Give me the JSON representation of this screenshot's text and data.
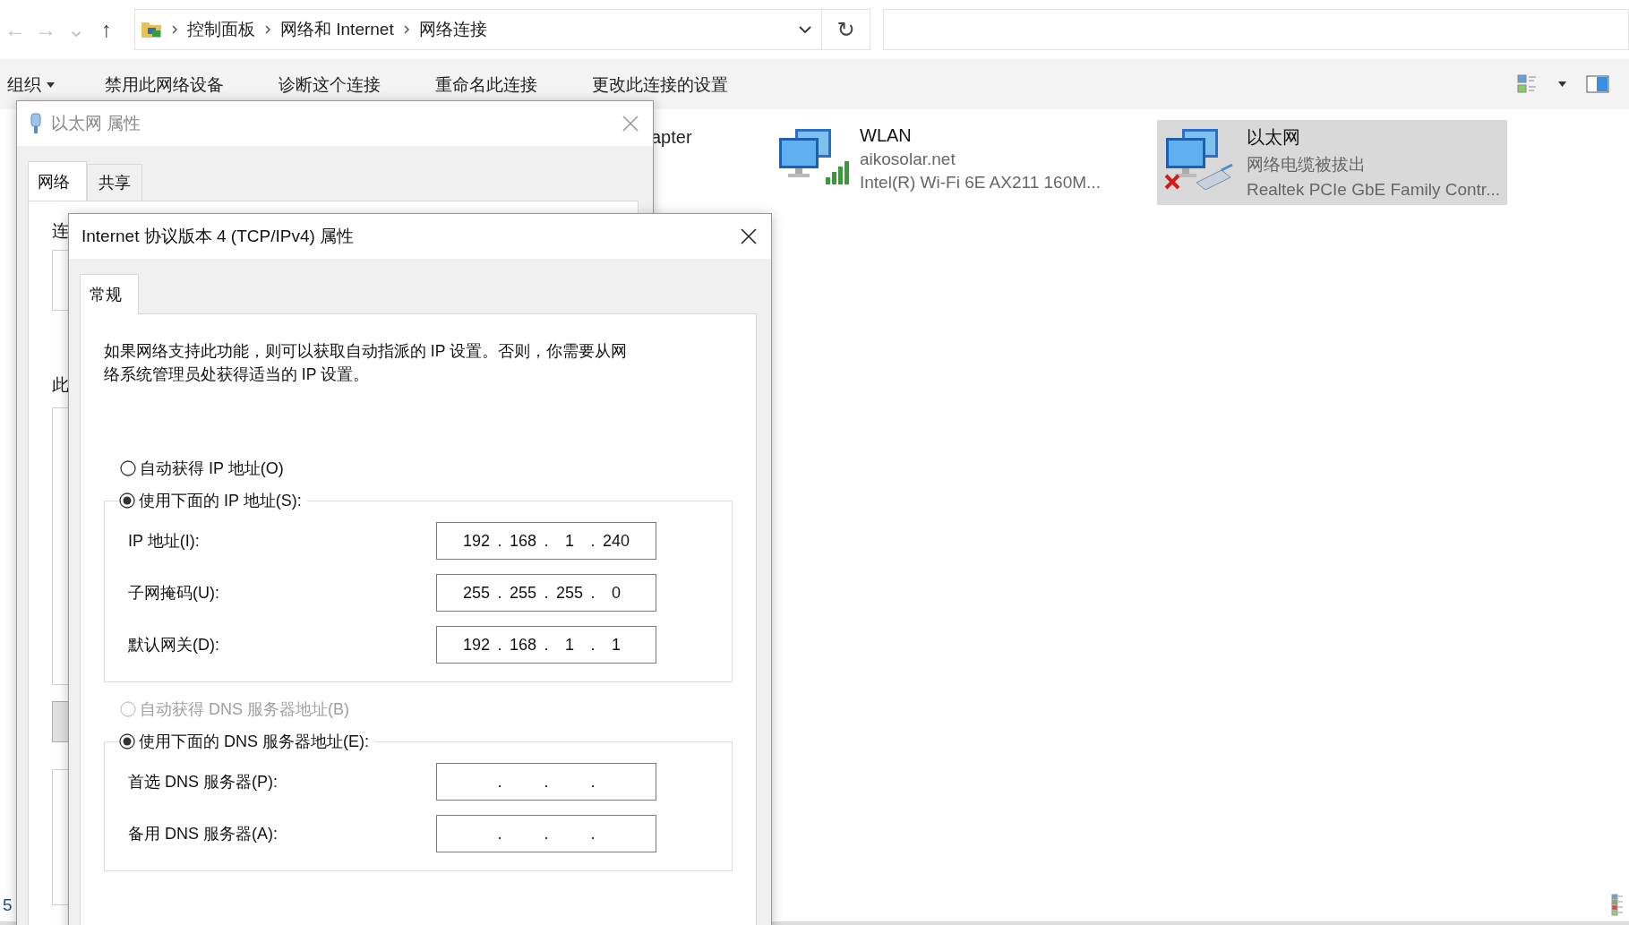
{
  "explorer": {
    "nav_buttons": [
      {
        "glyph": "←",
        "disabled": true
      },
      {
        "glyph": "→",
        "disabled": true
      },
      {
        "glyph": "⌄",
        "disabled": true
      },
      {
        "glyph": "↑",
        "disabled": false
      }
    ],
    "breadcrumbs": [
      "控制面板",
      "网络和 Internet",
      "网络连接"
    ],
    "refresh": "↻",
    "toolbar": [
      {
        "label": "组织",
        "dropdown": true
      },
      {
        "label": "禁用此网络设备",
        "dropdown": false
      },
      {
        "label": "诊断这个连接",
        "dropdown": false
      },
      {
        "label": "重命名此连接",
        "dropdown": false
      },
      {
        "label": "更改此连接的设置",
        "dropdown": false
      }
    ],
    "covered_item_label": "apter",
    "connections": [
      {
        "kind": "wifi",
        "name": "WLAN",
        "status": "aikosolar.net",
        "device": "Intel(R) Wi-Fi 6E AX211 160M...",
        "selected": false
      },
      {
        "kind": "ethernet",
        "name": "以太网",
        "status": "网络电缆被拔出",
        "device": "Realtek PCIe GbE Family Contr...",
        "selected": true
      }
    ],
    "status_bar": {
      "count": "5"
    }
  },
  "ethernet_properties": {
    "title": "以太网 属性",
    "active": false,
    "tabs": [
      {
        "label": "网络",
        "selected": true
      },
      {
        "label": "共享",
        "selected": false
      }
    ],
    "covered_labels": [
      "连",
      "此"
    ]
  },
  "ipv4_properties": {
    "title": "Internet 协议版本 4 (TCP/IPv4) 属性",
    "active": true,
    "tabs": [
      {
        "label": "常规",
        "selected": true
      }
    ],
    "description": "如果网络支持此功能，则可以获取自动指派的 IP 设置。否则，你需要从网络系统管理员处获得适当的 IP 设置。",
    "ip_separator": ".",
    "sections": [
      {
        "options": [
          {
            "label": "自动获得 IP 地址(O)",
            "selected": false,
            "disabled": false
          },
          {
            "label": "使用下面的 IP 地址(S):",
            "selected": true,
            "disabled": false
          }
        ],
        "fields": [
          {
            "label": "IP 地址(I):",
            "octets": [
              "192",
              "168",
              "1",
              "240"
            ]
          },
          {
            "label": "子网掩码(U):",
            "octets": [
              "255",
              "255",
              "255",
              "0"
            ]
          },
          {
            "label": "默认网关(D):",
            "octets": [
              "192",
              "168",
              "1",
              "1"
            ]
          }
        ]
      },
      {
        "options": [
          {
            "label": "自动获得 DNS 服务器地址(B)",
            "selected": false,
            "disabled": true
          },
          {
            "label": "使用下面的 DNS 服务器地址(E):",
            "selected": true,
            "disabled": false
          }
        ],
        "fields": [
          {
            "label": "首选 DNS 服务器(P):"
          },
          {
            "label": "备用 DNS 服务器(A):"
          }
        ]
      }
    ]
  }
}
